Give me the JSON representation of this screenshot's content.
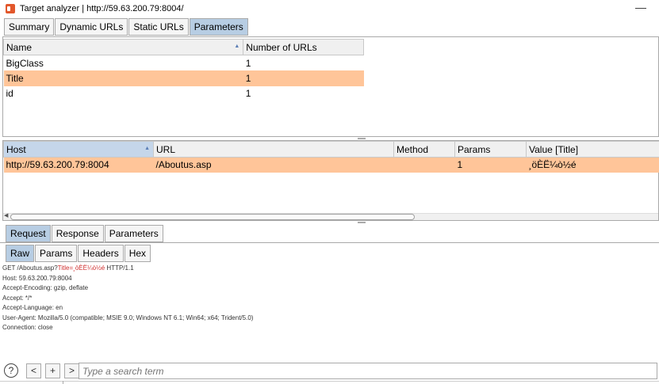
{
  "window": {
    "title": "Target analyzer | http://59.63.200.79:8004/"
  },
  "top_tabs": [
    {
      "label": "Summary"
    },
    {
      "label": "Dynamic URLs"
    },
    {
      "label": "Static URLs"
    },
    {
      "label": "Parameters"
    }
  ],
  "params_table": {
    "columns": [
      "Name",
      "Number of URLs"
    ],
    "rows": [
      {
        "name": "BigClass",
        "count": "1"
      },
      {
        "name": "Title",
        "count": "1"
      },
      {
        "name": "id",
        "count": "1"
      }
    ],
    "selected_row": 1
  },
  "urls_table": {
    "columns": [
      "Host",
      "URL",
      "Method",
      "Params",
      "Value [Title]"
    ],
    "rows": [
      {
        "host": "http://59.63.200.79:8004",
        "url": "/Aboutus.asp",
        "method": "",
        "params": "1",
        "value": "¸öÈË¼ò½é"
      }
    ]
  },
  "request_tabs": [
    {
      "label": "Request"
    },
    {
      "label": "Response"
    },
    {
      "label": "Parameters"
    }
  ],
  "view_tabs": [
    {
      "label": "Raw"
    },
    {
      "label": "Params"
    },
    {
      "label": "Headers"
    },
    {
      "label": "Hex"
    }
  ],
  "raw_request": {
    "first_line_pre": "GET /Aboutus.asp?",
    "first_line_param": "Title=¸öÈË¼ò½é",
    "first_line_post": " HTTP/1.1",
    "lines": [
      "Host: 59.63.200.79:8004",
      "Accept-Encoding: gzip, deflate",
      "Accept: */*",
      "Accept-Language: en",
      "User-Agent: Mozilla/5.0 (compatible; MSIE 9.0; Windows NT 6.1; Win64; x64; Trident/5.0)",
      "Connection: close"
    ]
  },
  "search": {
    "help_label": "?",
    "prev_label": "<",
    "add_label": "+",
    "next_label": ">",
    "placeholder": "Type a search term"
  }
}
